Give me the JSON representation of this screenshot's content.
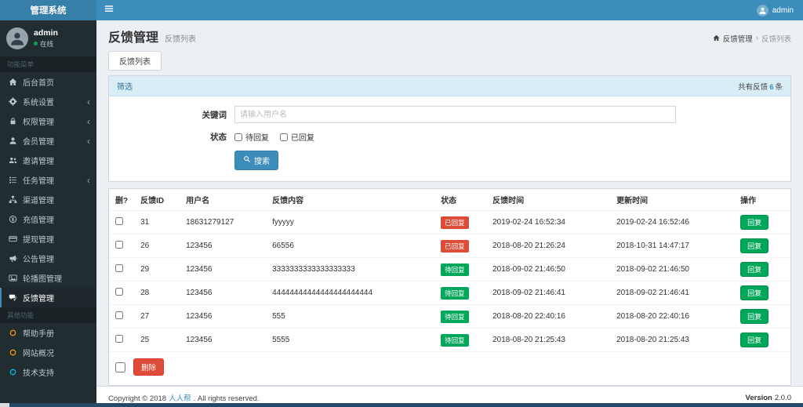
{
  "topbar": {
    "logo": "管理系统",
    "user": "admin"
  },
  "sidebar": {
    "user": {
      "name": "admin",
      "status": "在线"
    },
    "section1": "功能菜单",
    "section2": "其他功能",
    "menu": [
      {
        "label": "后台首页",
        "icon": "home",
        "arrow": false,
        "active": false
      },
      {
        "label": "系统设置",
        "icon": "gear",
        "arrow": true,
        "active": false
      },
      {
        "label": "权限管理",
        "icon": "lock",
        "arrow": true,
        "active": false
      },
      {
        "label": "会员管理",
        "icon": "user",
        "arrow": true,
        "active": false
      },
      {
        "label": "邀请管理",
        "icon": "users",
        "arrow": false,
        "active": false
      },
      {
        "label": "任务管理",
        "icon": "tasks",
        "arrow": true,
        "active": false
      },
      {
        "label": "渠道管理",
        "icon": "sitemap",
        "arrow": false,
        "active": false
      },
      {
        "label": "充值管理",
        "icon": "money",
        "arrow": false,
        "active": false
      },
      {
        "label": "提现管理",
        "icon": "credit-card",
        "arrow": false,
        "active": false
      },
      {
        "label": "公告管理",
        "icon": "bullhorn",
        "arrow": false,
        "active": false
      },
      {
        "label": "轮播图管理",
        "icon": "image",
        "arrow": false,
        "active": false
      },
      {
        "label": "反馈管理",
        "icon": "comments",
        "arrow": false,
        "active": true
      }
    ],
    "menu2": [
      {
        "label": "帮助手册",
        "icon": "circle",
        "color": "#f39c12"
      },
      {
        "label": "网站概况",
        "icon": "circle",
        "color": "#f39c12"
      },
      {
        "label": "技术支持",
        "icon": "circle",
        "color": "#00c0ef"
      }
    ]
  },
  "content": {
    "title": "反馈管理",
    "subtitle": "反馈列表",
    "breadcrumb": {
      "root": "反馈管理",
      "sep": "›",
      "current": "反馈列表"
    },
    "tab": "反馈列表",
    "filter": {
      "header": "筛选",
      "count_prefix": "共有反馈",
      "count": "6",
      "count_suffix": "条",
      "keyword_label": "关键词",
      "keyword_placeholder": "请输入用户名",
      "status_label": "状态",
      "checkbox_pending": "待回复",
      "checkbox_replied": "已回复",
      "search_button": "搜索"
    },
    "table": {
      "headers": [
        "删?",
        "反馈ID",
        "用户名",
        "反馈内容",
        "状态",
        "反馈时间",
        "更新时间",
        "操作"
      ],
      "rows": [
        {
          "id": "31",
          "username": "18631279127",
          "content": "fyyyyy",
          "status": "已回复",
          "status_type": "replied",
          "feedback_time": "2019-02-24 16:52:34",
          "update_time": "2019-02-24 16:52:46",
          "action": "回复"
        },
        {
          "id": "26",
          "username": "123456",
          "content": "66556",
          "status": "已回复",
          "status_type": "replied",
          "feedback_time": "2018-08-20 21:26:24",
          "update_time": "2018-10-31 14:47:17",
          "action": "回复"
        },
        {
          "id": "29",
          "username": "123456",
          "content": "3333333333333333333",
          "status": "待回复",
          "status_type": "pending",
          "feedback_time": "2018-09-02 21:46:50",
          "update_time": "2018-09-02 21:46:50",
          "action": "回复"
        },
        {
          "id": "28",
          "username": "123456",
          "content": "44444444444444444444444",
          "status": "待回复",
          "status_type": "pending",
          "feedback_time": "2018-09-02 21:46:41",
          "update_time": "2018-09-02 21:46:41",
          "action": "回复"
        },
        {
          "id": "27",
          "username": "123456",
          "content": "555",
          "status": "待回复",
          "status_type": "pending",
          "feedback_time": "2018-08-20 22:40:16",
          "update_time": "2018-08-20 22:40:16",
          "action": "回复"
        },
        {
          "id": "25",
          "username": "123456",
          "content": "5555",
          "status": "待回复",
          "status_type": "pending",
          "feedback_time": "2018-08-20 21:25:43",
          "update_time": "2018-08-20 21:25:43",
          "action": "回复"
        }
      ],
      "delete_button": "删除"
    }
  },
  "footer": {
    "copyright_prefix": "Copyright © 2018",
    "brand": "人人帮",
    "copyright_suffix": ". All rights reserved.",
    "version_label": "Version",
    "version": "2.0.0"
  },
  "colors": {
    "topbar": "#3c8dbc",
    "sidebar": "#222d32",
    "replied_badge": "#dd4b39",
    "pending_badge": "#00a65a",
    "reply_button": "#00a65a",
    "delete_button": "#dd4b39",
    "search_button": "#3c8dbc"
  }
}
